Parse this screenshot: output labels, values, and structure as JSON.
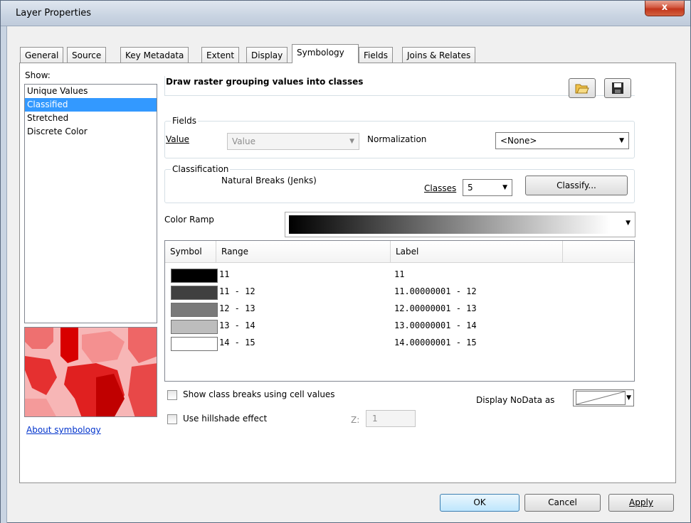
{
  "window": {
    "title": "Layer Properties",
    "close_glyph": "x"
  },
  "tabs": [
    {
      "label": "General"
    },
    {
      "label": "Source"
    },
    {
      "label": "Key Metadata"
    },
    {
      "label": "Extent"
    },
    {
      "label": "Display"
    },
    {
      "label": "Symbology",
      "active": true
    },
    {
      "label": "Fields"
    },
    {
      "label": "Joins & Relates"
    }
  ],
  "show": {
    "label": "Show:",
    "items": [
      {
        "label": "Unique Values"
      },
      {
        "label": "Classified",
        "selected": true
      },
      {
        "label": "Stretched"
      },
      {
        "label": "Discrete Color"
      }
    ],
    "about_link": "About symbology"
  },
  "main": {
    "heading": "Draw raster grouping values into classes",
    "fields": {
      "title": "Fields",
      "value_label": "Value",
      "value_selected": "Value",
      "normalization_label": "Normalization",
      "normalization_selected": "<None>"
    },
    "classification": {
      "title": "Classification",
      "method": "Natural Breaks (Jenks)",
      "classes_label": "Classes",
      "classes_value": "5",
      "classify_button": "Classify..."
    },
    "color_ramp_label": "Color Ramp",
    "table": {
      "headers": [
        "Symbol",
        "Range",
        "Label"
      ],
      "rows": [
        {
          "color": "#000000",
          "range": "11",
          "label": "11"
        },
        {
          "color": "#404040",
          "range": "11 - 12",
          "label": "11.00000001 - 12"
        },
        {
          "color": "#7a7a7a",
          "range": "12 - 13",
          "label": "12.00000001 - 13"
        },
        {
          "color": "#bdbdbd",
          "range": "13 - 14",
          "label": "13.00000001 - 14"
        },
        {
          "color": "#ffffff",
          "range": "14 - 15",
          "label": "14.00000001 - 15"
        }
      ]
    },
    "show_breaks_label": "Show class breaks using cell values",
    "hillshade_label": "Use hillshade effect",
    "z_label": "Z:",
    "z_value": "1",
    "nodata_label": "Display NoData as"
  },
  "buttons": {
    "ok": "OK",
    "cancel": "Cancel",
    "apply": "Apply"
  }
}
